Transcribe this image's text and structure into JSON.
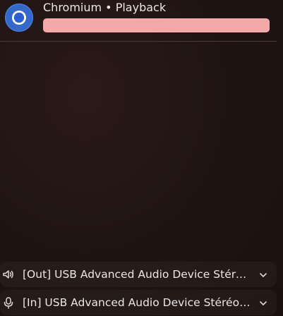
{
  "stream": {
    "icon": "chromium-icon",
    "title": "Chromium • Playback",
    "volume_fraction": 1.0,
    "slider_color": "#f3a9a8"
  },
  "devices": {
    "output": {
      "icon": "speaker-icon",
      "label": "[Out] USB Advanced Audio Device Stéréo analogique"
    },
    "input": {
      "icon": "microphone-icon",
      "label": "[In] USB Advanced Audio Device Stéréo analogique"
    }
  }
}
